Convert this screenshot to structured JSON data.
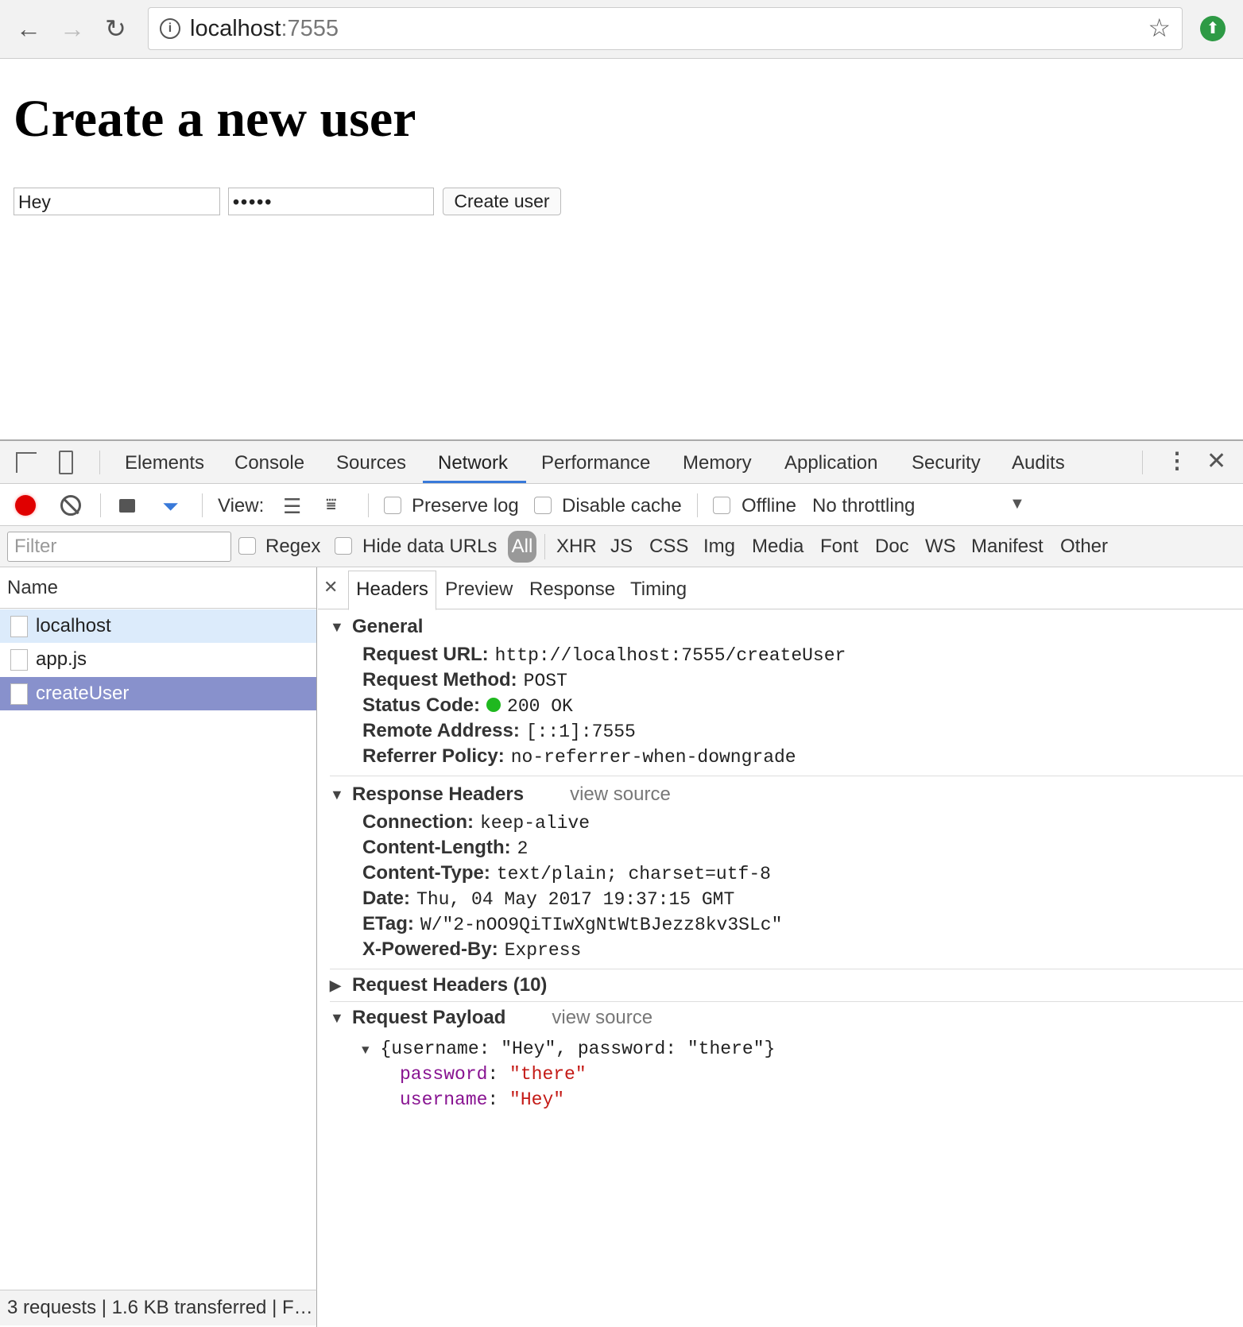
{
  "browser": {
    "url_host": "localhost",
    "url_port": ":7555"
  },
  "page": {
    "title": "Create a new user",
    "username_value": "Hey",
    "password_value": "•••••",
    "submit_label": "Create user"
  },
  "devtools": {
    "tabs": [
      "Elements",
      "Console",
      "Sources",
      "Network",
      "Performance",
      "Memory",
      "Application",
      "Security",
      "Audits"
    ],
    "active_tab": "Network",
    "toolbar": {
      "view_label": "View:",
      "preserve_log": "Preserve log",
      "disable_cache": "Disable cache",
      "offline": "Offline",
      "throttling": "No throttling"
    },
    "filter": {
      "placeholder": "Filter",
      "regex": "Regex",
      "hide_data_urls": "Hide data URLs",
      "types": [
        "All",
        "XHR",
        "JS",
        "CSS",
        "Img",
        "Media",
        "Font",
        "Doc",
        "WS",
        "Manifest",
        "Other"
      ]
    },
    "requests": {
      "header": "Name",
      "items": [
        "localhost",
        "app.js",
        "createUser"
      ],
      "selected": "createUser"
    },
    "footer": "3 requests | 1.6 KB transferred | F…",
    "detail_tabs": [
      "Headers",
      "Preview",
      "Response",
      "Timing"
    ],
    "general": {
      "title": "General",
      "rows": [
        [
          "Request URL:",
          "http://localhost:7555/createUser"
        ],
        [
          "Request Method:",
          "POST"
        ],
        [
          "Status Code:",
          "200 OK"
        ],
        [
          "Remote Address:",
          "[::1]:7555"
        ],
        [
          "Referrer Policy:",
          "no-referrer-when-downgrade"
        ]
      ]
    },
    "response_headers": {
      "title": "Response Headers",
      "view_source": "view source",
      "rows": [
        [
          "Connection:",
          "keep-alive"
        ],
        [
          "Content-Length:",
          "2"
        ],
        [
          "Content-Type:",
          "text/plain; charset=utf-8"
        ],
        [
          "Date:",
          "Thu, 04 May 2017 19:37:15 GMT"
        ],
        [
          "ETag:",
          "W/\"2-nOO9QiTIwXgNtWtBJezz8kv3SLc\""
        ],
        [
          "X-Powered-By:",
          "Express"
        ]
      ]
    },
    "request_headers": {
      "title": "Request Headers (10)"
    },
    "payload": {
      "title": "Request Payload",
      "view_source": "view source",
      "summary": "{username: \"Hey\", password: \"there\"}",
      "props": [
        [
          "password",
          "\"there\""
        ],
        [
          "username",
          "\"Hey\""
        ]
      ]
    }
  },
  "colors": {
    "accent": "#3879d9",
    "selected_row": "#8891cc",
    "hover_row": "#dcebfb",
    "record": "#e00000"
  }
}
